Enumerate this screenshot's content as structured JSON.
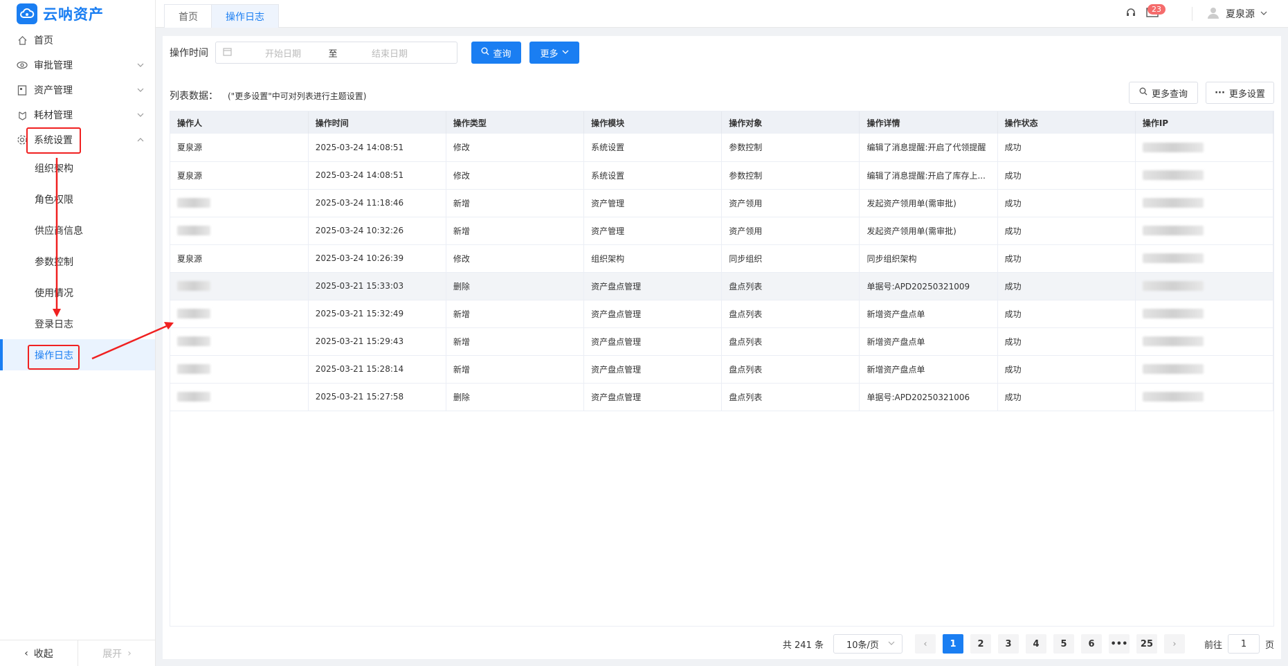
{
  "app": {
    "name": "云呐资产"
  },
  "sidebar": {
    "items": [
      {
        "label": "首页",
        "icon": "home-icon"
      },
      {
        "label": "审批管理",
        "icon": "eye-icon"
      },
      {
        "label": "资产管理",
        "icon": "asset-icon"
      },
      {
        "label": "耗材管理",
        "icon": "supplies-icon"
      },
      {
        "label": "系统设置",
        "icon": "gear-icon"
      }
    ],
    "submenu": [
      "组织架构",
      "角色权限",
      "供应商信息",
      "参数控制",
      "使用情况",
      "登录日志",
      "操作日志"
    ],
    "collapse_label": "收起",
    "expand_label": "展开"
  },
  "tabs": [
    "首页",
    "操作日志"
  ],
  "header": {
    "message_count": "23",
    "user_name": "夏泉源"
  },
  "filter": {
    "label": "操作时间",
    "start_placeholder": "开始日期",
    "separator": "至",
    "end_placeholder": "结束日期",
    "query_label": "查询",
    "more_label": "更多"
  },
  "list": {
    "label": "列表数据：",
    "hint": "(\"更多设置\"中可对列表进行主题设置)",
    "more_query_label": "更多查询",
    "more_settings_label": "更多设置"
  },
  "table": {
    "columns": [
      "操作人",
      "操作时间",
      "操作类型",
      "操作模块",
      "操作对象",
      "操作详情",
      "操作状态",
      "操作IP"
    ],
    "rows": [
      [
        "夏泉源",
        "2025-03-24 14:08:51",
        "修改",
        "系统设置",
        "参数控制",
        "编辑了消息提醒:开启了代领提醒",
        "成功"
      ],
      [
        "夏泉源",
        "2025-03-24 14:08:51",
        "修改",
        "系统设置",
        "参数控制",
        "编辑了消息提醒:开启了库存上...",
        "成功"
      ],
      [
        "",
        "2025-03-24 11:18:46",
        "新增",
        "资产管理",
        "资产领用",
        "发起资产领用单(需审批)",
        "成功"
      ],
      [
        "",
        "2025-03-24 10:32:26",
        "新增",
        "资产管理",
        "资产领用",
        "发起资产领用单(需审批)",
        "成功"
      ],
      [
        "夏泉源",
        "2025-03-24 10:26:39",
        "修改",
        "组织架构",
        "同步组织",
        "同步组织架构",
        "成功"
      ],
      [
        "",
        "2025-03-21 15:33:03",
        "删除",
        "资产盘点管理",
        "盘点列表",
        "单据号:APD20250321009",
        "成功"
      ],
      [
        "",
        "2025-03-21 15:32:49",
        "新增",
        "资产盘点管理",
        "盘点列表",
        "新增资产盘点单",
        "成功"
      ],
      [
        "",
        "2025-03-21 15:29:43",
        "新增",
        "资产盘点管理",
        "盘点列表",
        "新增资产盘点单",
        "成功"
      ],
      [
        "",
        "2025-03-21 15:28:14",
        "新增",
        "资产盘点管理",
        "盘点列表",
        "新增资产盘点单",
        "成功"
      ],
      [
        "",
        "2025-03-21 15:27:58",
        "删除",
        "资产盘点管理",
        "盘点列表",
        "单据号:APD20250321006",
        "成功"
      ]
    ]
  },
  "pagination": {
    "total": "共 241 条",
    "page_size": "10条/页",
    "pages": [
      "1",
      "2",
      "3",
      "4",
      "5",
      "6",
      "•••",
      "25"
    ],
    "goto_prefix": "前往",
    "goto_value": "1",
    "goto_suffix": "页"
  },
  "colors": {
    "primary": "#1a7ef2",
    "annotation": "#f02020"
  }
}
